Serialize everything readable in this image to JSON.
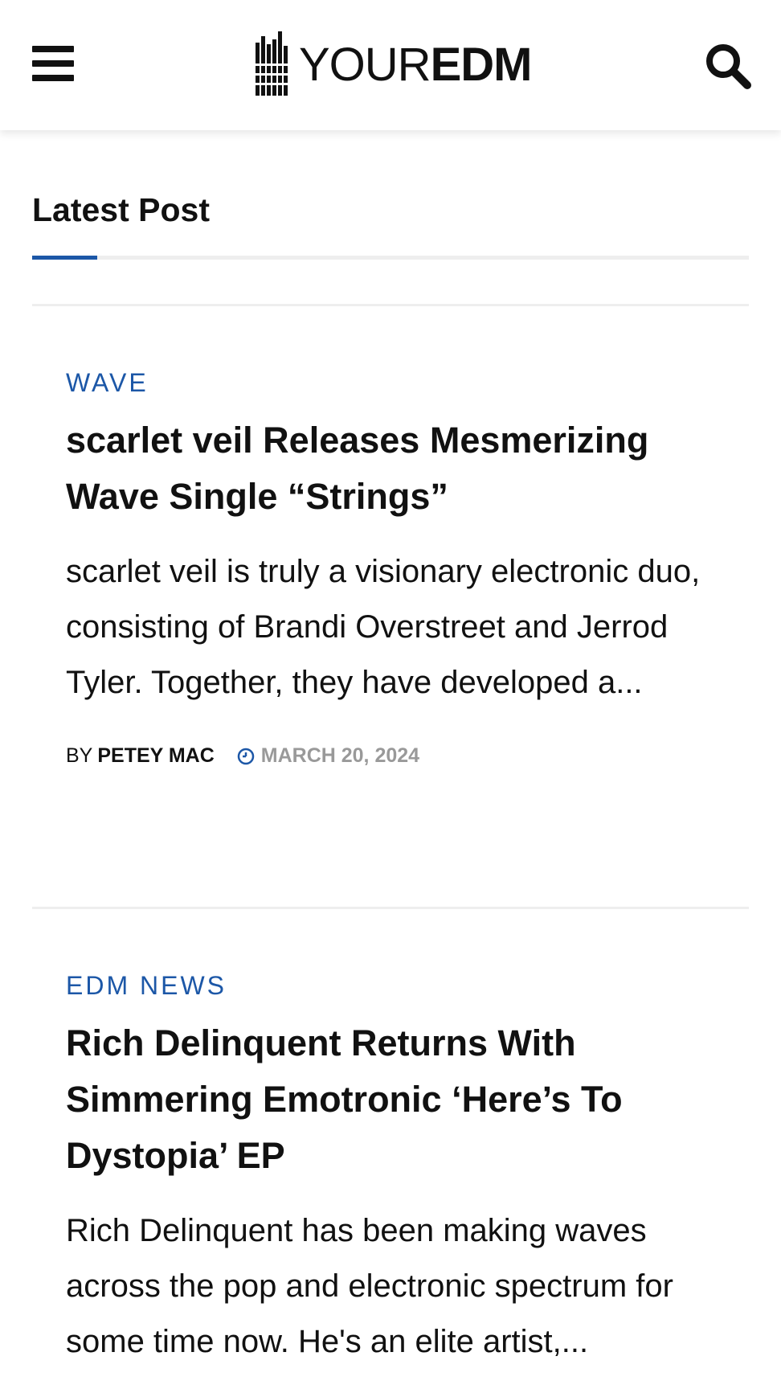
{
  "header": {
    "logo": {
      "light": "YOUR",
      "bold": "EDM"
    }
  },
  "section": {
    "title": "Latest Post",
    "accent_color": "#1c57a7"
  },
  "posts": [
    {
      "category": "WAVE",
      "title": "scarlet veil Releases Mesmerizing Wave Single “Strings”",
      "excerpt": "scarlet veil is truly a visionary electronic duo, consisting of Brandi Overstreet and Jerrod Tyler. Together, they have developed a...",
      "by": "BY",
      "author": "PETEY MAC",
      "date": "MARCH 20, 2024"
    },
    {
      "category": "EDM NEWS",
      "title": "Rich Delinquent Returns With Simmering Emotronic ‘Here’s To Dystopia’ EP",
      "excerpt": "Rich Delinquent has been making waves across the pop and electronic spectrum for some time now. He's an elite artist,..."
    }
  ]
}
